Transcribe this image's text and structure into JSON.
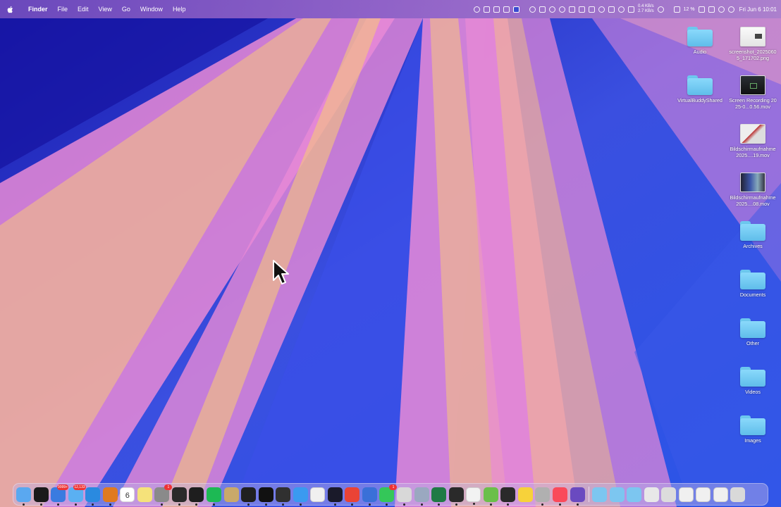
{
  "menubar": {
    "app_name": "Finder",
    "menus": [
      "File",
      "Edit",
      "View",
      "Go",
      "Window",
      "Help"
    ],
    "status": {
      "net_up": "0.4 KB/s",
      "net_down": "2.7 KB/s",
      "battery": "12 %",
      "clock": "Fri Jun 6  10:01"
    }
  },
  "desktop": {
    "column_left": [
      {
        "label": "Audio",
        "kind": "folder"
      },
      {
        "label": "VirtualBuddyShared",
        "kind": "folder"
      }
    ],
    "column_right": [
      {
        "label": "screenshot_20250605_171702.png",
        "kind": "thumb-light"
      },
      {
        "label": "Screen Recording 2025-0...0.56.mov",
        "kind": "thumb-dark"
      },
      {
        "label": "Bildschirmaufnahme 2025....19.mov",
        "kind": "thumb-mixed"
      },
      {
        "label": "Bildschirmaufnahme 2025....08.mov",
        "kind": "thumb-blue"
      },
      {
        "label": "Archives",
        "kind": "folder"
      },
      {
        "label": "Documents",
        "kind": "folder"
      },
      {
        "label": "Other",
        "kind": "folder"
      },
      {
        "label": "Videos",
        "kind": "folder"
      },
      {
        "label": "Images",
        "kind": "folder"
      }
    ]
  },
  "dock": {
    "apps": [
      {
        "name": "finder",
        "color": "#5aa8f0",
        "running": true
      },
      {
        "name": "app-black",
        "color": "#1a1a1a",
        "running": true
      },
      {
        "name": "spark-mail",
        "color": "#3a7be0",
        "badge": "9999+",
        "running": true
      },
      {
        "name": "mail",
        "color": "#5ab0f2",
        "badge": "12,133",
        "running": true
      },
      {
        "name": "vscode",
        "color": "#2a8ae0",
        "running": true
      },
      {
        "name": "sublime-text",
        "color": "#e07a20",
        "running": true
      },
      {
        "name": "calendar",
        "color": "#ffffff",
        "text": "6",
        "running": false
      },
      {
        "name": "notes",
        "color": "#f5e27a",
        "running": false
      },
      {
        "name": "system-settings",
        "color": "#8a8a8a",
        "badge": "1",
        "running": true
      },
      {
        "name": "terminal-1",
        "color": "#2a2a2a",
        "running": true
      },
      {
        "name": "terminal-2",
        "color": "#1e1e1e",
        "running": true
      },
      {
        "name": "spotify",
        "color": "#1db954",
        "running": true
      },
      {
        "name": "archive-utility",
        "color": "#c9a96a",
        "running": false
      },
      {
        "name": "terminal-3",
        "color": "#202020",
        "running": true
      },
      {
        "name": "terminal-4",
        "color": "#111111",
        "running": true
      },
      {
        "name": "terminal-5",
        "color": "#303030",
        "running": true
      },
      {
        "name": "safari",
        "color": "#3a9af0",
        "running": true
      },
      {
        "name": "pages",
        "color": "#f0f0f0",
        "running": false
      },
      {
        "name": "app-dark",
        "color": "#1a1a2a",
        "running": true
      },
      {
        "name": "chrome",
        "color": "#ea4335",
        "running": true
      },
      {
        "name": "xcode",
        "color": "#3a70d8",
        "running": true
      },
      {
        "name": "messages",
        "color": "#34c759",
        "badge": "1",
        "running": true
      },
      {
        "name": "chatgpt",
        "color": "#d8d8d8",
        "running": true
      },
      {
        "name": "screen-sharing",
        "color": "#9aa8c0",
        "running": true
      },
      {
        "name": "excel",
        "color": "#1f7a45",
        "running": true
      },
      {
        "name": "app-grid",
        "color": "#2a2a2a",
        "running": true
      },
      {
        "name": "preview",
        "color": "#f2f2f2",
        "running": true
      },
      {
        "name": "alien-app",
        "color": "#6bbf4a",
        "running": true
      },
      {
        "name": "terminal-6",
        "color": "#2a2a2a",
        "running": true
      },
      {
        "name": "stickies",
        "color": "#f7d23a",
        "running": false
      },
      {
        "name": "globe-app",
        "color": "#b0b0b0",
        "running": true
      },
      {
        "name": "music",
        "color": "#fa4a5a",
        "running": true
      },
      {
        "name": "app-purple",
        "color": "#6a4ac0",
        "running": true
      }
    ],
    "stack": [
      {
        "name": "applications-folder",
        "color": "#7cc6f0"
      },
      {
        "name": "downloads-folder",
        "color": "#7cc6f0"
      },
      {
        "name": "documents-folder",
        "color": "#7cc6f0"
      },
      {
        "name": "info-stack",
        "color": "#e8e8e8"
      },
      {
        "name": "file-stack-1",
        "color": "#dcdcdc"
      },
      {
        "name": "file-stack-2",
        "color": "#f0f0f0"
      },
      {
        "name": "file-stack-3",
        "color": "#f0f0f0"
      },
      {
        "name": "file-stack-4",
        "color": "#f0f0f0"
      },
      {
        "name": "trash",
        "color": "#d9d9d9"
      }
    ]
  }
}
